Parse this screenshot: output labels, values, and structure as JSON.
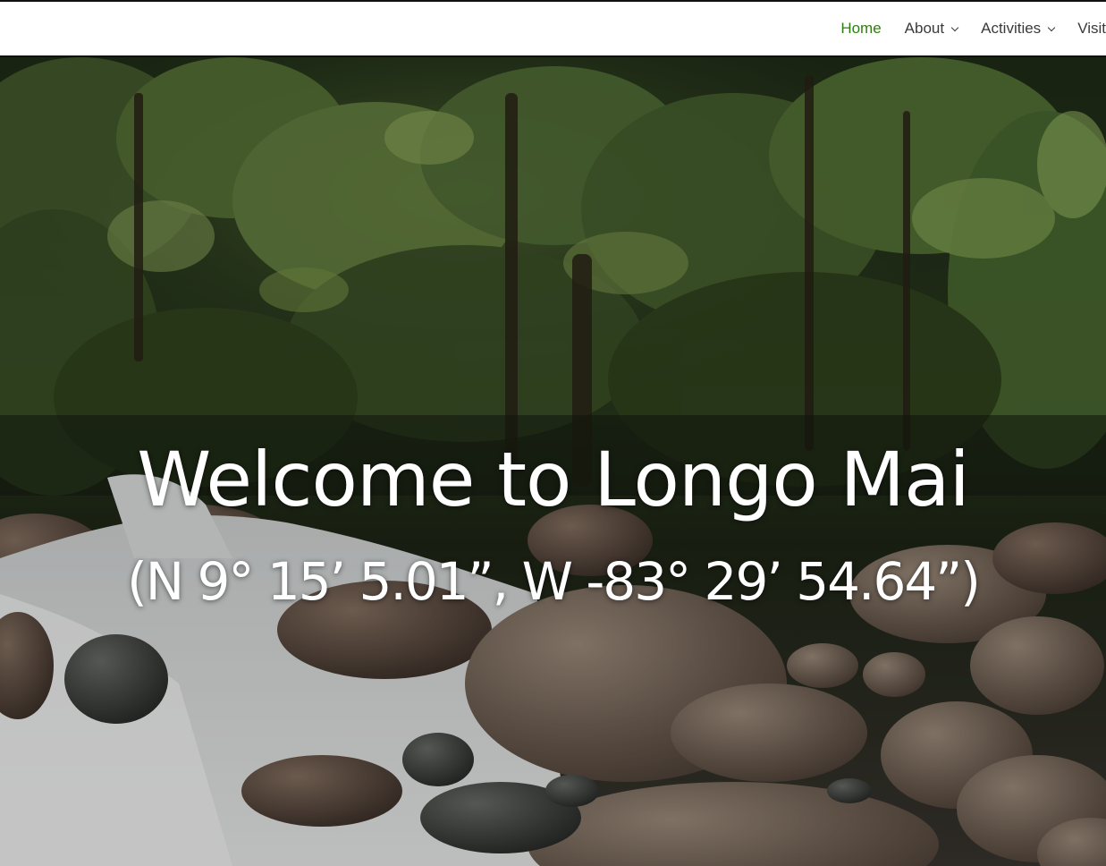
{
  "nav": {
    "items": [
      {
        "label": "Home",
        "active": true
      },
      {
        "label": "About",
        "has_dropdown": true
      },
      {
        "label": "Activities",
        "has_dropdown": true
      },
      {
        "label": "Visit"
      }
    ],
    "active_color": "#2f7d12",
    "text_color": "#3a3a3a"
  },
  "hero": {
    "title": "Welcome to Longo Mai",
    "coordinates": "(N 9° 15’ 5.01”, W -83° 29’ 54.64”)",
    "background": "rainforest river with rocks and rushing water"
  }
}
